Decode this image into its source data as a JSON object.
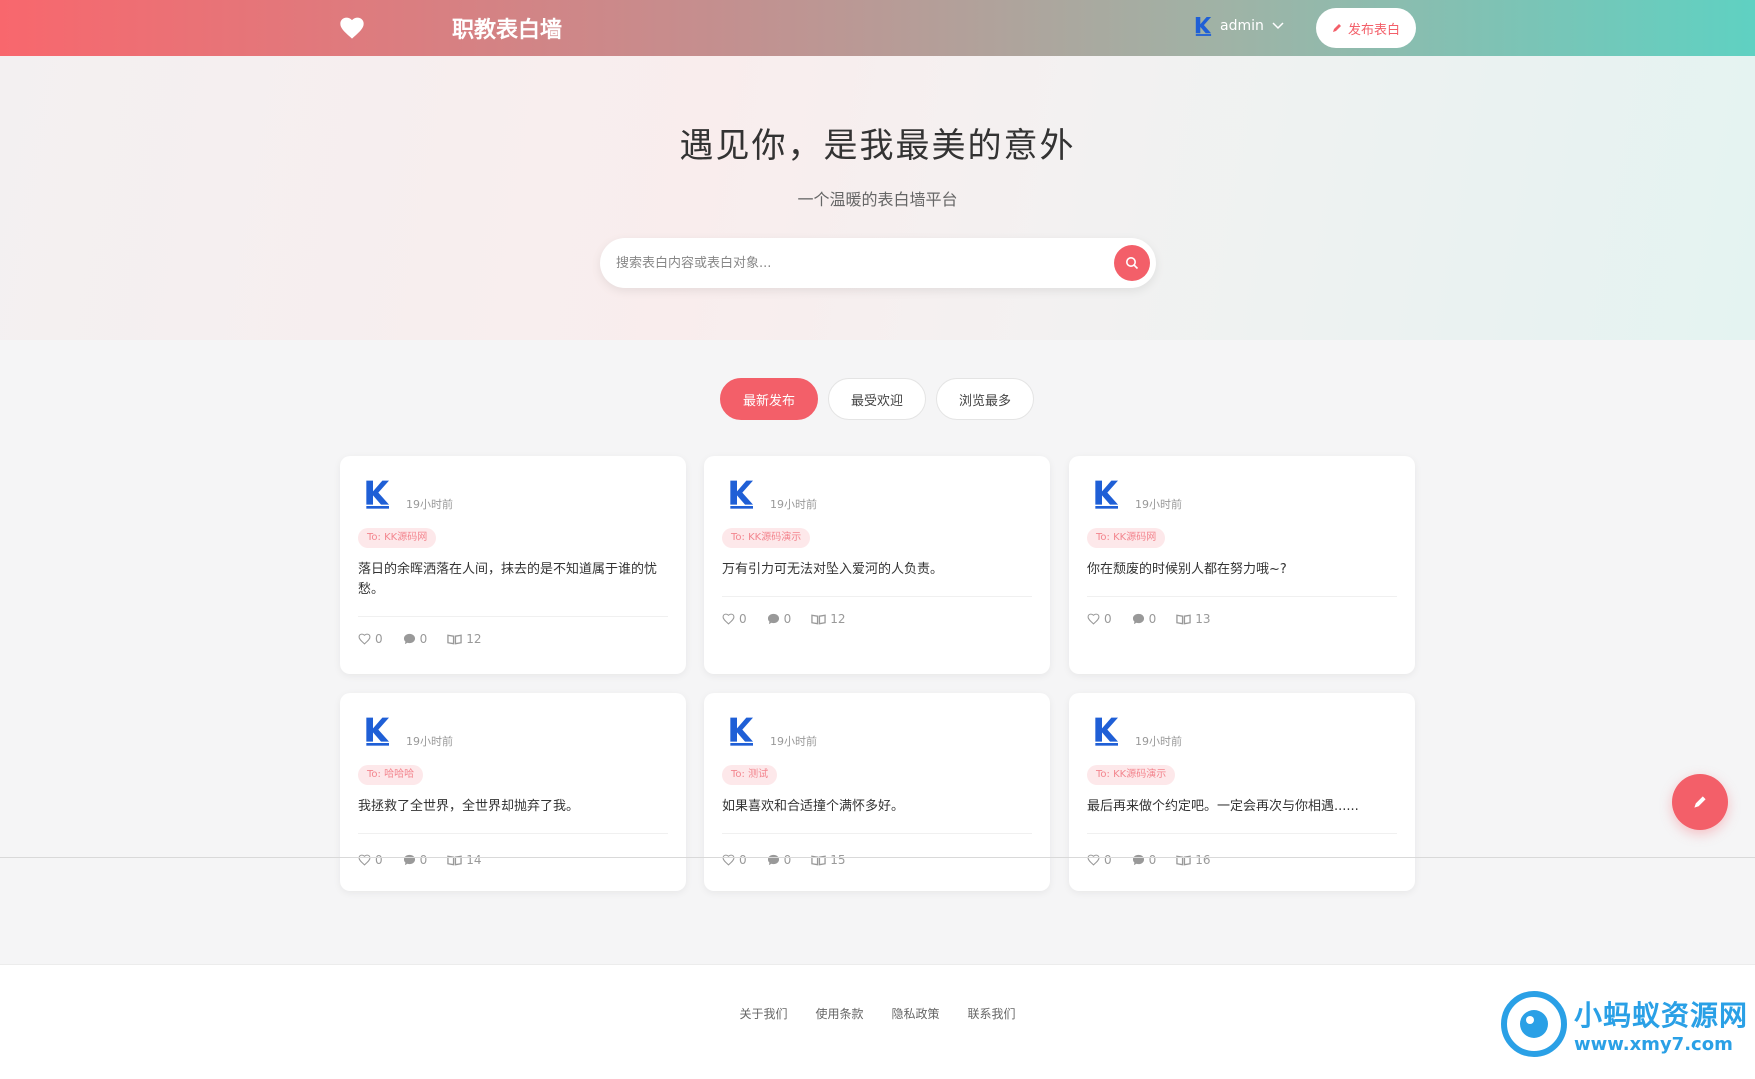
{
  "header": {
    "brand": "职教表白墙",
    "username": "admin",
    "publish_label": "发布表白"
  },
  "hero": {
    "title": "遇见你，是我最美的意外",
    "subtitle": "一个温暖的表白墙平台",
    "search_placeholder": "搜索表白内容或表白对象..."
  },
  "tabs": [
    {
      "label": "最新发布",
      "active": true
    },
    {
      "label": "最受欢迎",
      "active": false
    },
    {
      "label": "浏览最多",
      "active": false
    }
  ],
  "cards": [
    {
      "time": "19小时前",
      "to": "To: KK源码网",
      "content": "落日的余晖洒落在人间，抹去的是不知道属于谁的忧愁。",
      "likes": "0",
      "comments": "0",
      "views": "12"
    },
    {
      "time": "19小时前",
      "to": "To: KK源码演示",
      "content": "万有引力可无法对坠入爱河的人负责。",
      "likes": "0",
      "comments": "0",
      "views": "12"
    },
    {
      "time": "19小时前",
      "to": "To: KK源码网",
      "content": "你在颓废的时候别人都在努力哦~?",
      "likes": "0",
      "comments": "0",
      "views": "13"
    },
    {
      "time": "19小时前",
      "to": "To: 哈哈哈",
      "content": "我拯救了全世界，全世界却抛弃了我。",
      "likes": "0",
      "comments": "0",
      "views": "14"
    },
    {
      "time": "19小时前",
      "to": "To: 测试",
      "content": "如果喜欢和合适撞个满怀多好。",
      "likes": "0",
      "comments": "0",
      "views": "15"
    },
    {
      "time": "19小时前",
      "to": "To: KK源码演示",
      "content": "最后再来做个约定吧。一定会再次与你相遇......",
      "likes": "0",
      "comments": "0",
      "views": "16"
    }
  ],
  "footer": {
    "links": [
      "关于我们",
      "使用条款",
      "隐私政策",
      "联系我们"
    ]
  },
  "watermark": {
    "title": "小蚂蚁资源网",
    "url": "www.xmy7.com"
  },
  "colors": {
    "accent": "#f35f69",
    "gradient_start": "#f8676d",
    "gradient_end": "#5fd1c2"
  }
}
